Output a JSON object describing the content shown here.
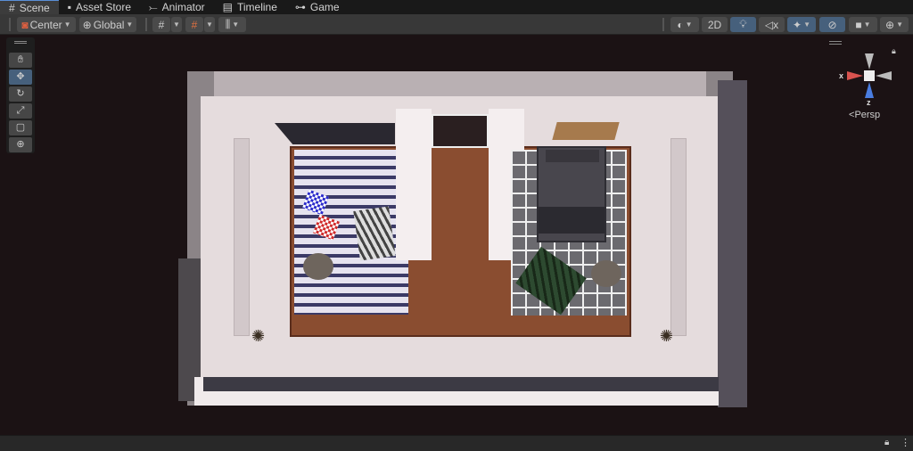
{
  "tabs": [
    {
      "label": "Scene",
      "icon": "grid-icon"
    },
    {
      "label": "Asset Store",
      "icon": "bag-icon"
    },
    {
      "label": "Animator",
      "icon": "animator-icon"
    },
    {
      "label": "Timeline",
      "icon": "film-icon"
    },
    {
      "label": "Game",
      "icon": "gamepad-icon"
    }
  ],
  "toolbar": {
    "pivot": "Center",
    "space": "Global",
    "mode_2d": "2D"
  },
  "gizmo": {
    "x_label": "x",
    "z_label": "z",
    "projection": "Persp"
  },
  "colors": {
    "accent": "#46607c",
    "x_axis": "#d9534f",
    "z_axis": "#4a7de0"
  }
}
